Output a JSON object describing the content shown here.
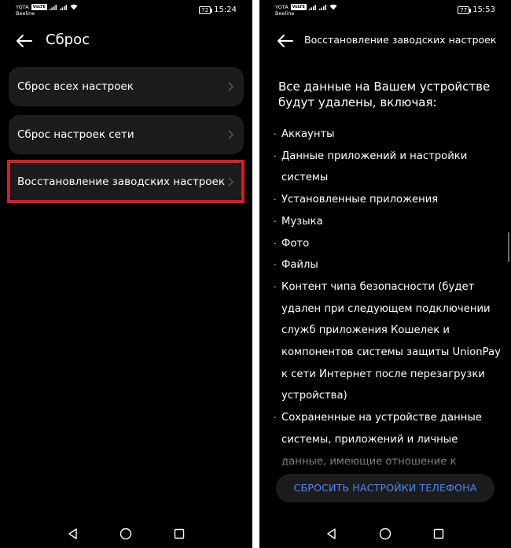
{
  "left_screen": {
    "status": {
      "carrier_top": "YOTA",
      "volte": "VoLTE",
      "carrier_bottom": "Beeline",
      "battery": "72",
      "time": "15:24"
    },
    "header": {
      "title": "Сброс"
    },
    "menu": [
      {
        "label": "Сброс всех настроек"
      },
      {
        "label": "Сброс настроек сети"
      },
      {
        "label": "Восстановление заводских настроек",
        "highlighted": true
      }
    ]
  },
  "right_screen": {
    "status": {
      "carrier_top": "YOTA",
      "volte": "VoLTE",
      "carrier_bottom": "Beeline",
      "battery": "77",
      "time": "15:53"
    },
    "header": {
      "title": "Восстановление заводских настроек"
    },
    "intro": "Все данные на Вашем устройстве будут удалены, включая:",
    "bullets": [
      "Аккаунты",
      "Данные приложений и настройки системы",
      "Установленные приложения",
      "Музыка",
      "Фото",
      "Файлы",
      "Контент чипа безопасности (будет удален при следующем подключении служб приложения Кошелек и компонентов системы защиты UnionPay к сети Интернет после перезагрузки устройства)",
      "Сохраненные на устройстве данные системы, приложений и личные данные, имеющие отношение к"
    ],
    "reset_button": "СБРОСИТЬ НАСТРОЙКИ ТЕЛЕФОНА"
  },
  "colors": {
    "background": "#000000",
    "card": "#1c1c1e",
    "accent": "#4e86f4",
    "highlight": "#e0191e",
    "text": "#ffffff"
  },
  "icons": [
    "back-arrow-icon",
    "chevron-right-icon",
    "signal-icon",
    "wifi-icon",
    "battery-icon",
    "nav-back-icon",
    "nav-home-icon",
    "nav-recent-icon"
  ]
}
